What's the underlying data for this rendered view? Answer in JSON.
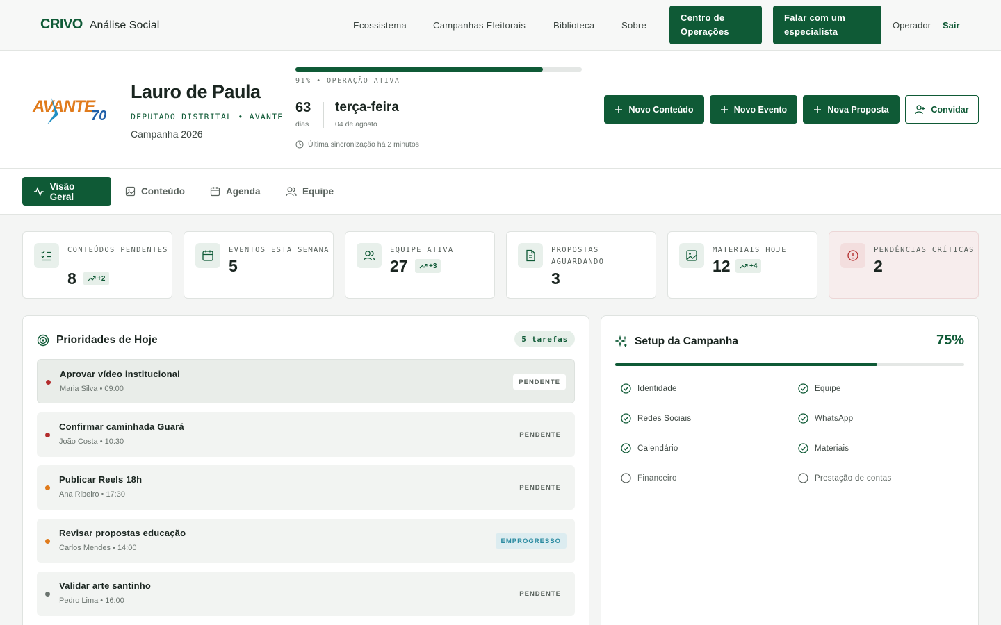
{
  "nav": {
    "brand": "CRIVO",
    "brand_sub": "Análise Social",
    "links": [
      "Ecossistema",
      "Campanhas Eleitorais",
      "Biblioteca",
      "Sobre"
    ],
    "ops_button": "Centro de Operações",
    "expert_button": "Falar com um especialista",
    "user": "Operador",
    "logout": "Sair"
  },
  "candidate": {
    "logo_text": "AVANTE",
    "logo_number": "70",
    "name": "Lauro de Paula",
    "role": "DEPUTADO DISTRITAL • AVANTE",
    "campaign": "Campanha 2026"
  },
  "operation": {
    "progress_pct": 91,
    "status_label": "91% • OPERAÇÃO ATIVA",
    "days": "63",
    "days_label": "dias",
    "weekday": "terça-feira",
    "date": "04 de agosto",
    "sync": "Última sincronização há 2 minutos"
  },
  "actions": {
    "new_content": "Novo Conteúdo",
    "new_event": "Novo Evento",
    "new_proposal": "Nova Proposta",
    "invite": "Convidar"
  },
  "tabs": [
    "Visão Geral",
    "Conteúdo",
    "Agenda",
    "Equipe"
  ],
  "stats": [
    {
      "label": "CONTEÚDOS PENDENTES",
      "value": "8",
      "badge": "+2",
      "icon": "list-check-icon"
    },
    {
      "label": "EVENTOS ESTA SEMANA",
      "value": "5",
      "badge": "",
      "icon": "calendar-icon"
    },
    {
      "label": "EQUIPE ATIVA",
      "value": "27",
      "badge": "+3",
      "icon": "users-icon"
    },
    {
      "label": "PROPOSTAS AGUARDANDO",
      "value": "3",
      "badge": "",
      "icon": "document-icon"
    },
    {
      "label": "MATERIAIS HOJE",
      "value": "12",
      "badge": "+4",
      "icon": "image-icon"
    },
    {
      "label": "PENDÊNCIAS CRÍTICAS",
      "value": "2",
      "badge": "",
      "icon": "alert-icon"
    }
  ],
  "priorities": {
    "title": "Prioridades de Hoje",
    "badge": "5 tarefas",
    "tasks": [
      {
        "title": "Aprovar vídeo institucional",
        "meta": "Maria Silva • 09:00",
        "status": "PENDENTE",
        "dot": "#b32d2d"
      },
      {
        "title": "Confirmar caminhada Guará",
        "meta": "João Costa • 10:30",
        "status": "PENDENTE",
        "dot": "#b32d2d"
      },
      {
        "title": "Publicar Reels 18h",
        "meta": "Ana Ribeiro • 17:30",
        "status": "PENDENTE",
        "dot": "#e07b1c"
      },
      {
        "title": "Revisar propostas educação",
        "meta": "Carlos Mendes • 14:00",
        "status": "EMPROGRESSO",
        "dot": "#e07b1c"
      },
      {
        "title": "Validar arte santinho",
        "meta": "Pedro Lima • 16:00",
        "status": "PENDENTE",
        "dot": "#6b746f"
      }
    ]
  },
  "setup": {
    "title": "Setup da Campanha",
    "pct_label": "75%",
    "pct": 75,
    "items": [
      {
        "label": "Identidade",
        "done": true
      },
      {
        "label": "Equipe",
        "done": true
      },
      {
        "label": "Redes Sociais",
        "done": true
      },
      {
        "label": "WhatsApp",
        "done": true
      },
      {
        "label": "Calendário",
        "done": true
      },
      {
        "label": "Materiais",
        "done": true
      },
      {
        "label": "Financeiro",
        "done": false
      },
      {
        "label": "Prestação de contas",
        "done": false
      }
    ]
  },
  "colors": {
    "primary": "#0f5a36",
    "critical": "#b32d2d",
    "warning": "#e07b1c"
  }
}
